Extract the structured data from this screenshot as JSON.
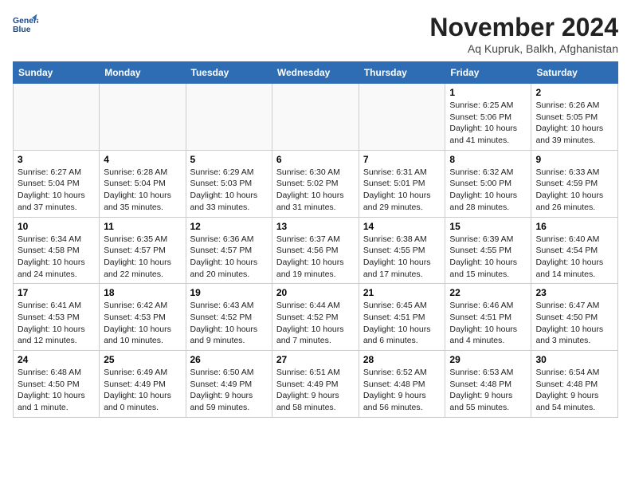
{
  "header": {
    "logo_line1": "General",
    "logo_line2": "Blue",
    "month": "November 2024",
    "location": "Aq Kupruk, Balkh, Afghanistan"
  },
  "weekdays": [
    "Sunday",
    "Monday",
    "Tuesday",
    "Wednesday",
    "Thursday",
    "Friday",
    "Saturday"
  ],
  "weeks": [
    [
      {
        "day": "",
        "info": ""
      },
      {
        "day": "",
        "info": ""
      },
      {
        "day": "",
        "info": ""
      },
      {
        "day": "",
        "info": ""
      },
      {
        "day": "",
        "info": ""
      },
      {
        "day": "1",
        "info": "Sunrise: 6:25 AM\nSunset: 5:06 PM\nDaylight: 10 hours\nand 41 minutes."
      },
      {
        "day": "2",
        "info": "Sunrise: 6:26 AM\nSunset: 5:05 PM\nDaylight: 10 hours\nand 39 minutes."
      }
    ],
    [
      {
        "day": "3",
        "info": "Sunrise: 6:27 AM\nSunset: 5:04 PM\nDaylight: 10 hours\nand 37 minutes."
      },
      {
        "day": "4",
        "info": "Sunrise: 6:28 AM\nSunset: 5:04 PM\nDaylight: 10 hours\nand 35 minutes."
      },
      {
        "day": "5",
        "info": "Sunrise: 6:29 AM\nSunset: 5:03 PM\nDaylight: 10 hours\nand 33 minutes."
      },
      {
        "day": "6",
        "info": "Sunrise: 6:30 AM\nSunset: 5:02 PM\nDaylight: 10 hours\nand 31 minutes."
      },
      {
        "day": "7",
        "info": "Sunrise: 6:31 AM\nSunset: 5:01 PM\nDaylight: 10 hours\nand 29 minutes."
      },
      {
        "day": "8",
        "info": "Sunrise: 6:32 AM\nSunset: 5:00 PM\nDaylight: 10 hours\nand 28 minutes."
      },
      {
        "day": "9",
        "info": "Sunrise: 6:33 AM\nSunset: 4:59 PM\nDaylight: 10 hours\nand 26 minutes."
      }
    ],
    [
      {
        "day": "10",
        "info": "Sunrise: 6:34 AM\nSunset: 4:58 PM\nDaylight: 10 hours\nand 24 minutes."
      },
      {
        "day": "11",
        "info": "Sunrise: 6:35 AM\nSunset: 4:57 PM\nDaylight: 10 hours\nand 22 minutes."
      },
      {
        "day": "12",
        "info": "Sunrise: 6:36 AM\nSunset: 4:57 PM\nDaylight: 10 hours\nand 20 minutes."
      },
      {
        "day": "13",
        "info": "Sunrise: 6:37 AM\nSunset: 4:56 PM\nDaylight: 10 hours\nand 19 minutes."
      },
      {
        "day": "14",
        "info": "Sunrise: 6:38 AM\nSunset: 4:55 PM\nDaylight: 10 hours\nand 17 minutes."
      },
      {
        "day": "15",
        "info": "Sunrise: 6:39 AM\nSunset: 4:55 PM\nDaylight: 10 hours\nand 15 minutes."
      },
      {
        "day": "16",
        "info": "Sunrise: 6:40 AM\nSunset: 4:54 PM\nDaylight: 10 hours\nand 14 minutes."
      }
    ],
    [
      {
        "day": "17",
        "info": "Sunrise: 6:41 AM\nSunset: 4:53 PM\nDaylight: 10 hours\nand 12 minutes."
      },
      {
        "day": "18",
        "info": "Sunrise: 6:42 AM\nSunset: 4:53 PM\nDaylight: 10 hours\nand 10 minutes."
      },
      {
        "day": "19",
        "info": "Sunrise: 6:43 AM\nSunset: 4:52 PM\nDaylight: 10 hours\nand 9 minutes."
      },
      {
        "day": "20",
        "info": "Sunrise: 6:44 AM\nSunset: 4:52 PM\nDaylight: 10 hours\nand 7 minutes."
      },
      {
        "day": "21",
        "info": "Sunrise: 6:45 AM\nSunset: 4:51 PM\nDaylight: 10 hours\nand 6 minutes."
      },
      {
        "day": "22",
        "info": "Sunrise: 6:46 AM\nSunset: 4:51 PM\nDaylight: 10 hours\nand 4 minutes."
      },
      {
        "day": "23",
        "info": "Sunrise: 6:47 AM\nSunset: 4:50 PM\nDaylight: 10 hours\nand 3 minutes."
      }
    ],
    [
      {
        "day": "24",
        "info": "Sunrise: 6:48 AM\nSunset: 4:50 PM\nDaylight: 10 hours\nand 1 minute."
      },
      {
        "day": "25",
        "info": "Sunrise: 6:49 AM\nSunset: 4:49 PM\nDaylight: 10 hours\nand 0 minutes."
      },
      {
        "day": "26",
        "info": "Sunrise: 6:50 AM\nSunset: 4:49 PM\nDaylight: 9 hours\nand 59 minutes."
      },
      {
        "day": "27",
        "info": "Sunrise: 6:51 AM\nSunset: 4:49 PM\nDaylight: 9 hours\nand 58 minutes."
      },
      {
        "day": "28",
        "info": "Sunrise: 6:52 AM\nSunset: 4:48 PM\nDaylight: 9 hours\nand 56 minutes."
      },
      {
        "day": "29",
        "info": "Sunrise: 6:53 AM\nSunset: 4:48 PM\nDaylight: 9 hours\nand 55 minutes."
      },
      {
        "day": "30",
        "info": "Sunrise: 6:54 AM\nSunset: 4:48 PM\nDaylight: 9 hours\nand 54 minutes."
      }
    ]
  ]
}
